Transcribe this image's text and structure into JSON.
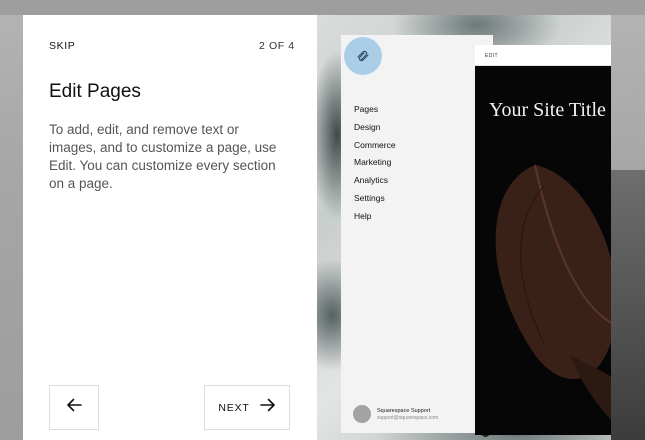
{
  "onboarding": {
    "skip_label": "SKIP",
    "step_counter": "2 OF 4",
    "title": "Edit Pages",
    "description": "To add, edit, and remove text or images, and to customize a page, use Edit. You can customize every section on a page.",
    "back_icon": "arrow-left-icon",
    "next_label": "NEXT",
    "next_icon": "arrow-right-icon"
  },
  "preview": {
    "logo_icon": "squarespace-logo-icon",
    "nav_items": [
      "Pages",
      "Design",
      "Commerce",
      "Marketing",
      "Analytics",
      "Settings",
      "Help"
    ],
    "support_name": "Squarespace Support",
    "support_email": "support@squarespace.com",
    "edit_label": "EDIT",
    "site_title": "Your Site Title"
  },
  "colors": {
    "logo_bg": "#aacde8",
    "panel_bg": "#f3f3f3",
    "site_bg": "#060606"
  }
}
